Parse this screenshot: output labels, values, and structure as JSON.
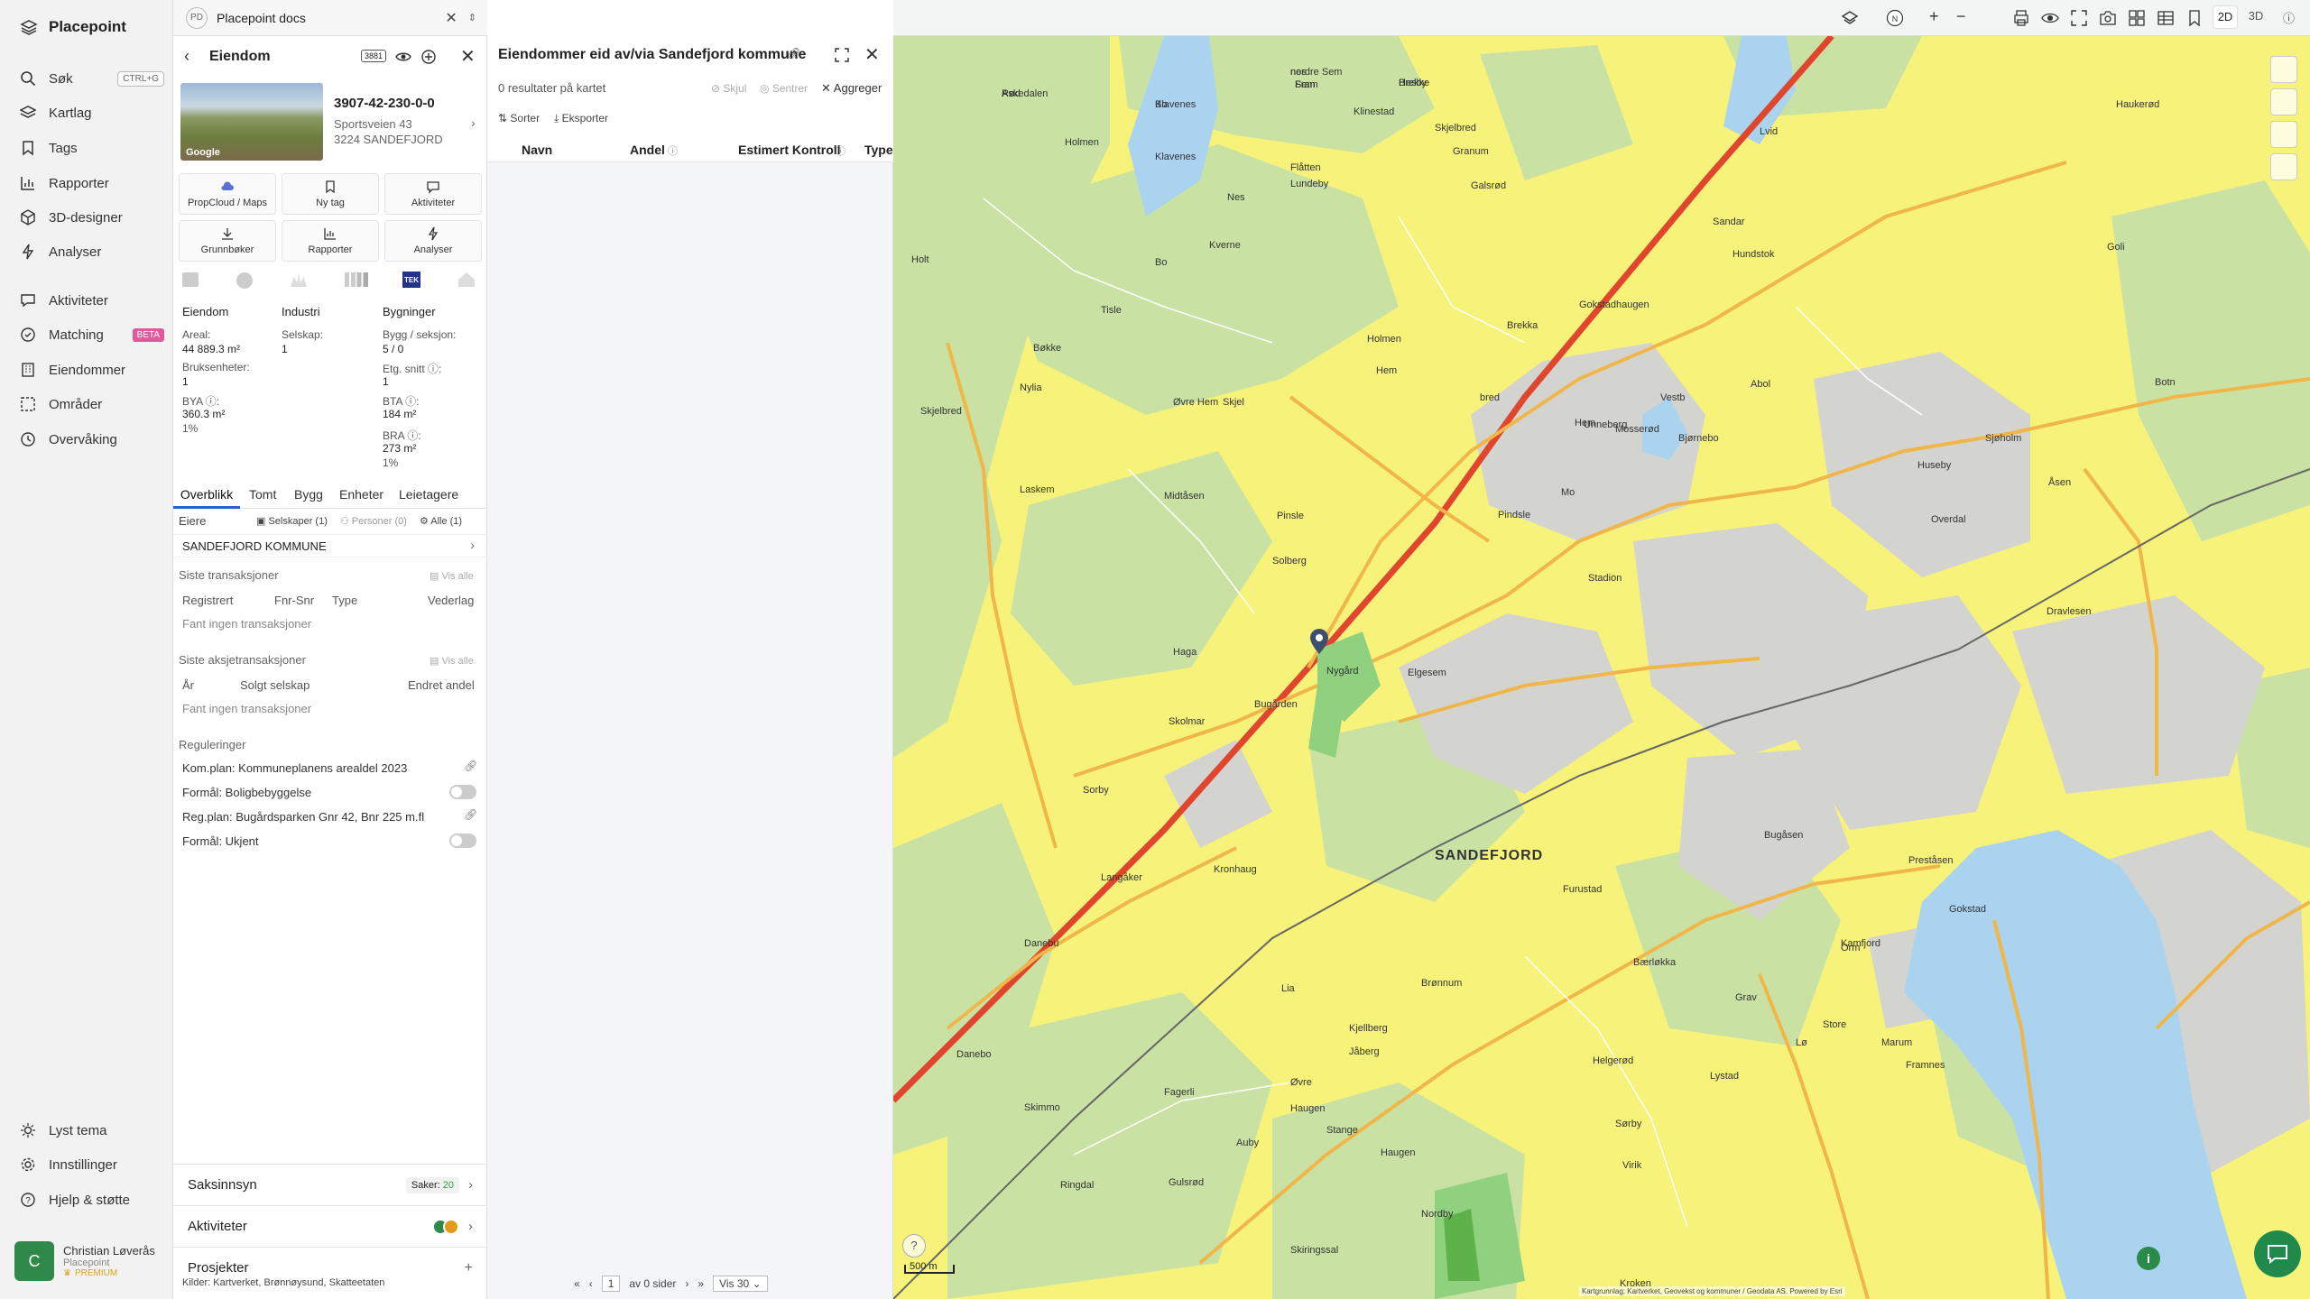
{
  "nav": {
    "brand": "Placepoint",
    "items": [
      {
        "label": "Søk",
        "icon": "search-icon",
        "shortcut": "CTRL+G"
      },
      {
        "label": "Kartlag",
        "icon": "layers-icon"
      },
      {
        "label": "Tags",
        "icon": "bookmark-icon"
      },
      {
        "label": "Rapporter",
        "icon": "chart-icon"
      },
      {
        "label": "3D-designer",
        "icon": "cube-icon"
      },
      {
        "label": "Analyser",
        "icon": "bolt-icon"
      },
      {
        "label": "Aktiviteter",
        "icon": "chat-icon"
      },
      {
        "label": "Matching",
        "icon": "match-icon",
        "badge": "BETA"
      },
      {
        "label": "Eiendommer",
        "icon": "building-icon"
      },
      {
        "label": "Områder",
        "icon": "area-icon"
      },
      {
        "label": "Overvåking",
        "icon": "watch-icon"
      }
    ],
    "bottom": [
      {
        "label": "Lyst tema",
        "icon": "sun-icon"
      },
      {
        "label": "Innstillinger",
        "icon": "gear-icon"
      },
      {
        "label": "Hjelp & støtte",
        "icon": "help-icon"
      }
    ],
    "user": {
      "initial": "C",
      "name": "Christian Løverås",
      "org": "Placepoint",
      "plan": "PREMIUM"
    }
  },
  "docs": {
    "badge": "PD",
    "title": "Placepoint docs"
  },
  "property": {
    "title": "Eiendom",
    "id_badge": "3881",
    "matrikkel": "3907-42-230-0-0",
    "address": "Sportsveien 43",
    "postal": "3224 SANDEFJORD",
    "photo_credit": "Google",
    "tiles": [
      {
        "label": "PropCloud / Maps",
        "icon": "cloud-icon"
      },
      {
        "label": "Ny tag",
        "icon": "bookmark-icon"
      },
      {
        "label": "Aktiviteter",
        "icon": "chat-icon"
      },
      {
        "label": "Grunnbøker",
        "icon": "download-icon"
      },
      {
        "label": "Rapporter",
        "icon": "chart-icon"
      },
      {
        "label": "Analyser",
        "icon": "bolt-icon"
      }
    ],
    "tek_badge": "TEK",
    "summary": {
      "col1_head": "Eiendom",
      "areal_label": "Areal:",
      "areal_value": "44 889.3 m²",
      "bruks_label": "Bruksenheter:",
      "bruks_value": "1",
      "bya_label": "BYA ⓘ:",
      "bya_value": "360.3 m²",
      "bya_pct": "1%",
      "col2_head": "Industri",
      "selskap_label": "Selskap:",
      "selskap_value": "1",
      "col3_head": "Bygninger",
      "bygg_label": "Bygg / seksjon:",
      "bygg_value": "5 / 0",
      "etg_label": "Etg. snitt ⓘ:",
      "etg_value": "1",
      "bta_label": "BTA ⓘ:",
      "bta_value": "184 m²",
      "bra_label": "BRA ⓘ:",
      "bra_value": "273 m²",
      "bra_pct": "1%"
    },
    "tabs": [
      "Overblikk",
      "Tomt",
      "Bygg",
      "Enheter",
      "Leietagere"
    ],
    "owners": {
      "label": "Eiere",
      "filters": [
        "Selskaper (1)",
        "Personer (0)",
        "Alle (1)"
      ],
      "owner": "SANDEFJORD KOMMUNE"
    },
    "transactions": {
      "title": "Siste transaksjoner",
      "show_all": "Vis alle",
      "cols": [
        "Registrert",
        "Fnr-Snr",
        "Type",
        "Vederlag"
      ],
      "empty": "Fant ingen transaksjoner"
    },
    "share_tx": {
      "title": "Siste aksjetransaksjoner",
      "show_all": "Vis alle",
      "cols": [
        "År",
        "Solgt selskap",
        "Endret andel"
      ],
      "empty": "Fant ingen transaksjoner"
    },
    "regulations": {
      "title": "Reguleringer",
      "items": [
        {
          "text": "Kom.plan: Kommuneplanens arealdel 2023"
        },
        {
          "text": "Formål: Boligbebyggelse"
        },
        {
          "text": "Reg.plan: Bugårdsparken Gnr 42, Bnr 225 m.fl"
        },
        {
          "text": "Formål: Ukjent"
        }
      ]
    },
    "accordions": {
      "saksinnsyn": "Saksinnsyn",
      "saker_label": "Saker:",
      "saker_count": "20",
      "aktiviteter": "Aktiviteter",
      "prosjekter": "Prosjekter"
    },
    "sources": "Kilder: Kartverket, Brønnøysund, Skatteetaten"
  },
  "results": {
    "title": "Eiendommer eid av/via Sandefjord kommune",
    "count": "0 resultater på kartet",
    "hide": "Skjul",
    "center": "Sentrer",
    "aggregate": "Aggreger",
    "sort": "Sorter",
    "export": "Eksporter",
    "columns": [
      "Navn",
      "Andel",
      "Estimert Kontroll",
      "Type"
    ],
    "pager": {
      "page": "1",
      "of": "av 0 sider",
      "per_page": "Vis 30"
    }
  },
  "map": {
    "view_modes": [
      "2D",
      "3D"
    ],
    "city_label": "SANDEFJORD",
    "scale": "500 m",
    "attribution": "Kartgrunnlag: Kartverket, Geovekst og kommuner / Geodata AS. Powered by Esri",
    "places": [
      "Askedalen",
      "Klavenes",
      "nordre Sem",
      "Sem",
      "Hesby",
      "Klinestad",
      "Skjelbred",
      "Granum",
      "Holmen",
      "Klavenes",
      "Flåtten",
      "Lundeby",
      "Bo",
      "Nes",
      "Tisle",
      "Holt",
      "Kverne",
      "Galsrød",
      "Skjelbred",
      "Bøkke",
      "Nylia",
      "Holmen",
      "Hem",
      "Øvre Hem",
      "Skjel",
      "bred",
      "Hem",
      "Mo",
      "Mosserød",
      "Laskem",
      "Midtåsen",
      "Pinsle",
      "Pindsle",
      "Elgesem",
      "Solberg",
      "Haga",
      "Skolmar",
      "Nygård",
      "Bugården",
      "Kronhaug",
      "Sorby",
      "Langåker",
      "Danebu",
      "Danebo",
      "Skimmo",
      "Fagerli",
      "Ringdal",
      "Gulsrød",
      "Haugen",
      "Auby",
      "Øvre",
      "Jåberg",
      "Stange",
      "Haugen",
      "Bærløkka",
      "Brønnum",
      "Furustad",
      "Lia",
      "Kjellberg",
      "Virik",
      "Nordby",
      "Skiringssal",
      "Kroken",
      "Lystad",
      "Sørby",
      "Marum",
      "Grav",
      "Framnes",
      "Orm",
      "Bugåsen",
      "Kamfjord",
      "Preståsen",
      "Gokstad",
      "Stadion",
      "Bjørnebo",
      "Sjøholm",
      "Åsen",
      "Dravlesen",
      "Overdal",
      "Unneberg",
      "Vestb",
      "Gokstadhaugen",
      "Brekka",
      "Sandar",
      "Lvid",
      "Hundstok",
      "Haukerød",
      "Goli",
      "Botn",
      "Huseby",
      "Abol",
      "Helgerød",
      "Lø",
      "Store",
      "Rød",
      "Bo",
      "nes",
      "Fram",
      "Brekke"
    ]
  }
}
